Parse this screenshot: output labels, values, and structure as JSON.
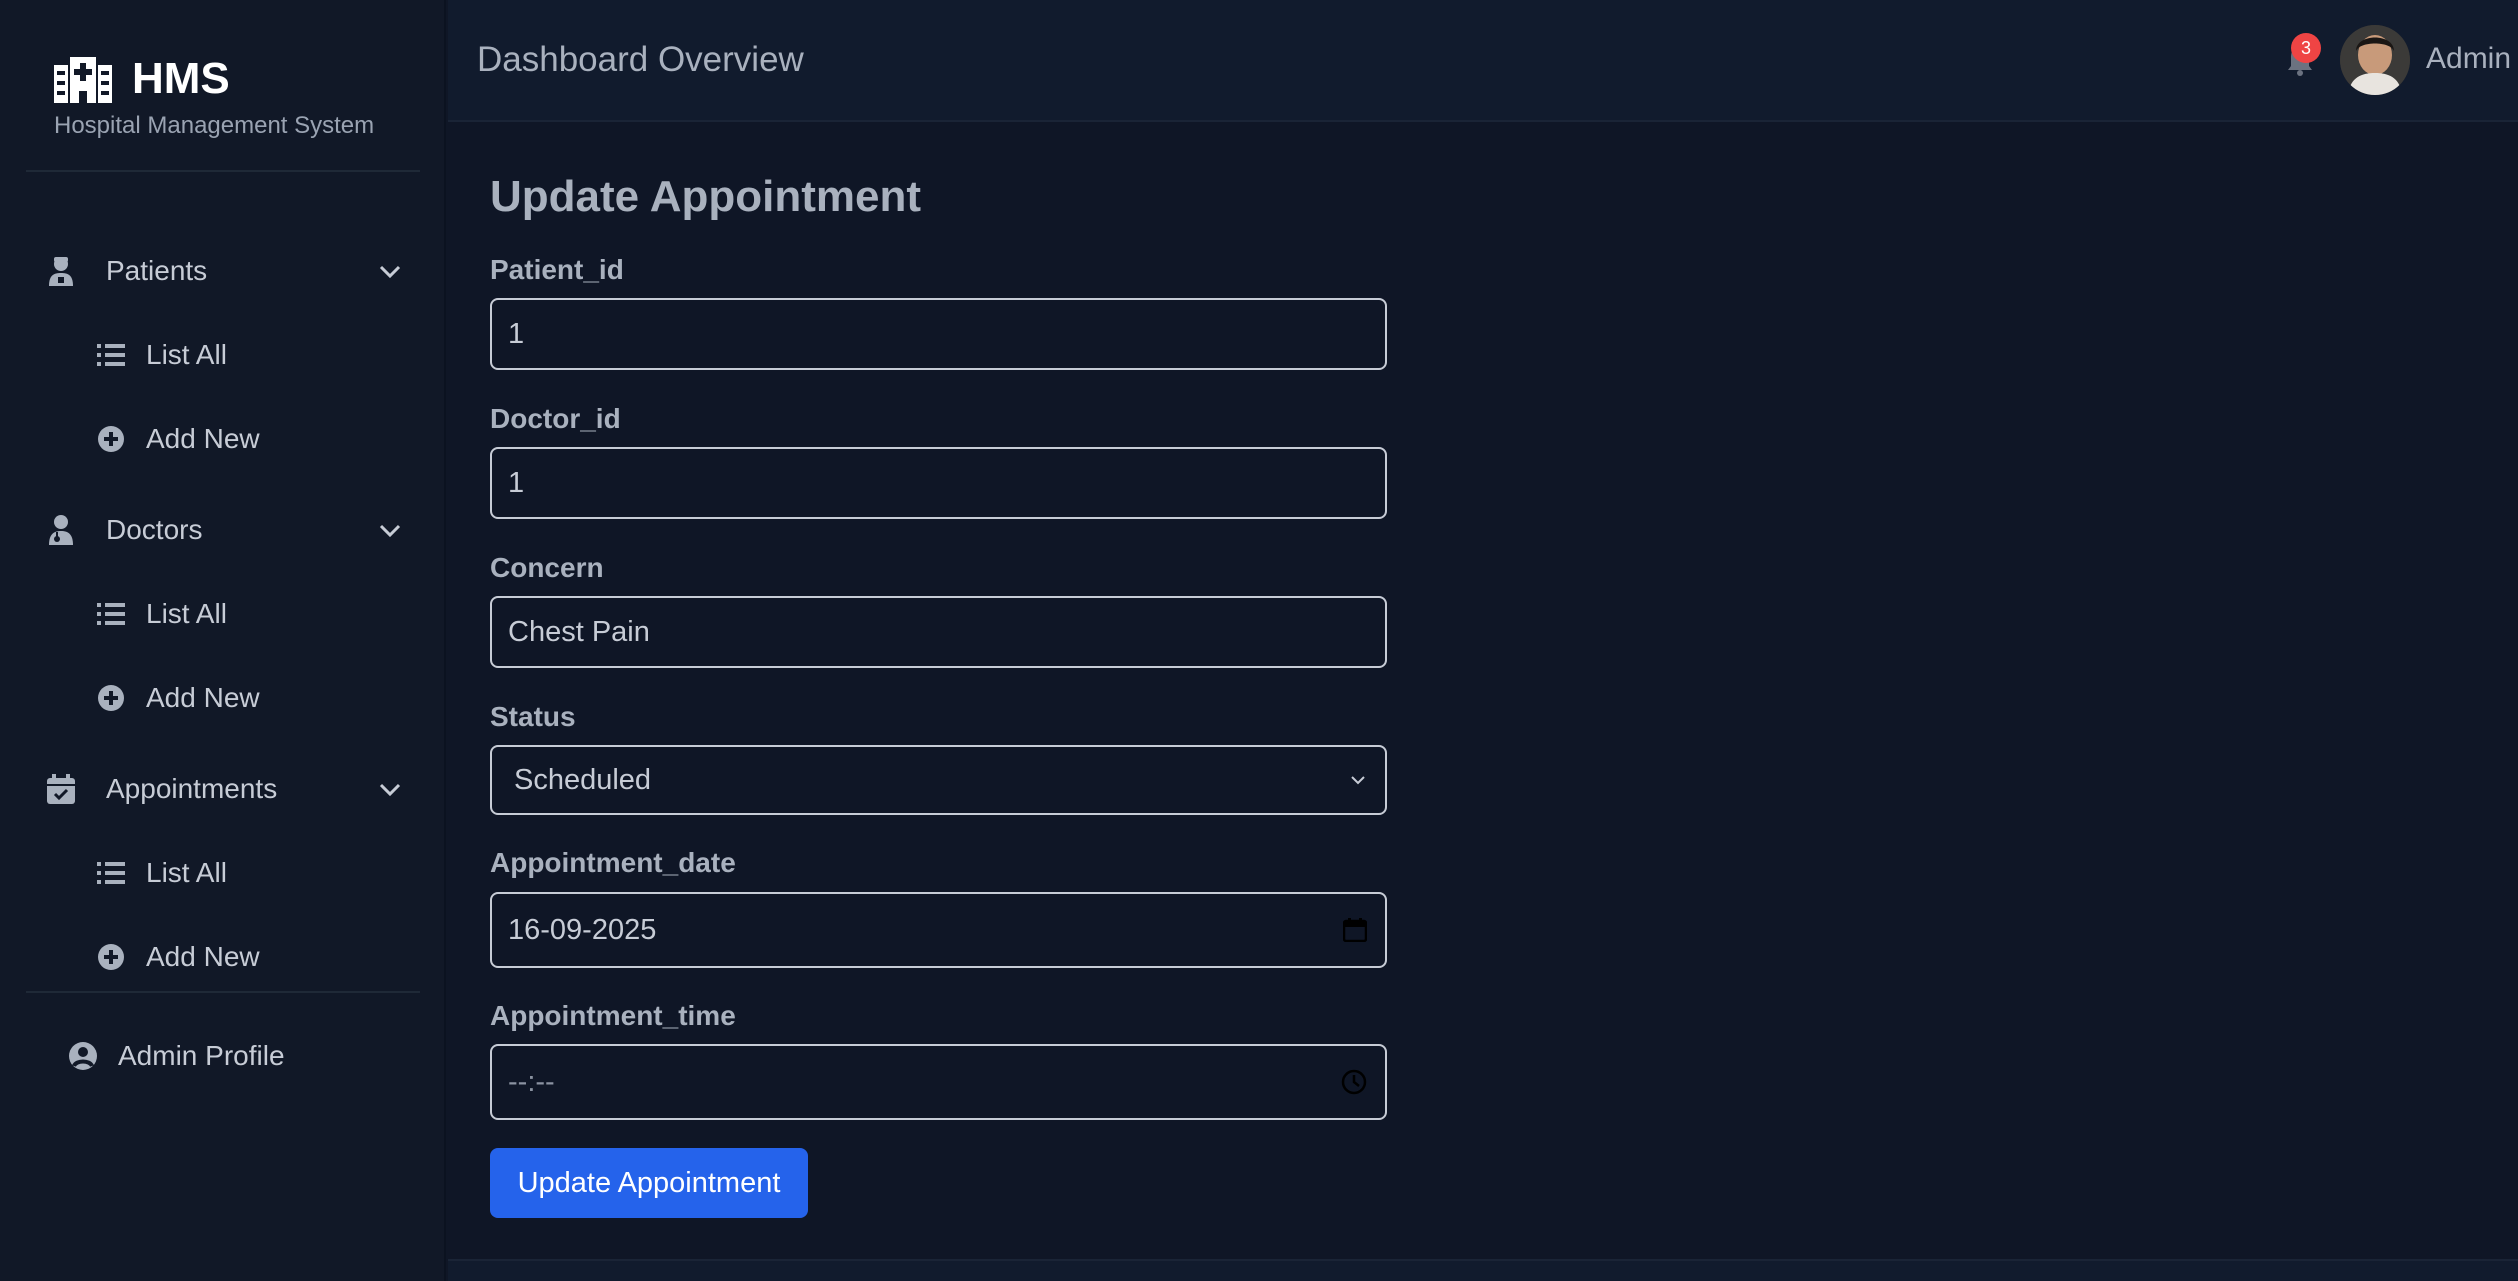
{
  "colors": {
    "background": "#0f1626",
    "sidebar": "#111827",
    "header": "#111b2d",
    "accent": "#2563eb",
    "badge": "#ef4444",
    "text": "#c7ccd6",
    "muted": "#a9b1be"
  },
  "brand": {
    "title": "HMS",
    "subtitle": "Hospital Management System",
    "icon": "hospital-icon"
  },
  "sidebar": {
    "groups": [
      {
        "label": "Patients",
        "icon": "patient-icon",
        "items": [
          {
            "label": "List All",
            "icon": "list-icon"
          },
          {
            "label": "Add New",
            "icon": "plus-circle-icon"
          }
        ]
      },
      {
        "label": "Doctors",
        "icon": "doctor-icon",
        "items": [
          {
            "label": "List All",
            "icon": "list-icon"
          },
          {
            "label": "Add New",
            "icon": "plus-circle-icon"
          }
        ]
      },
      {
        "label": "Appointments",
        "icon": "calendar-check-icon",
        "items": [
          {
            "label": "List All",
            "icon": "list-icon"
          },
          {
            "label": "Add New",
            "icon": "plus-circle-icon"
          }
        ]
      }
    ],
    "profile": {
      "label": "Admin Profile",
      "icon": "user-circle-icon"
    }
  },
  "header": {
    "title": "Dashboard Overview",
    "notifications_count": "3",
    "user_name": "Admin"
  },
  "form": {
    "title": "Update Appointment",
    "fields": [
      {
        "label": "Patient_id",
        "value": "1"
      },
      {
        "label": "Doctor_id",
        "value": "1"
      },
      {
        "label": "Concern",
        "value": "Chest Pain"
      },
      {
        "label": "Status",
        "value": "Scheduled"
      },
      {
        "label": "Appointment_date",
        "value": "16-09-2025"
      },
      {
        "label": "Appointment_time",
        "value": "--:--"
      }
    ],
    "submit_label": "Update Appointment"
  }
}
